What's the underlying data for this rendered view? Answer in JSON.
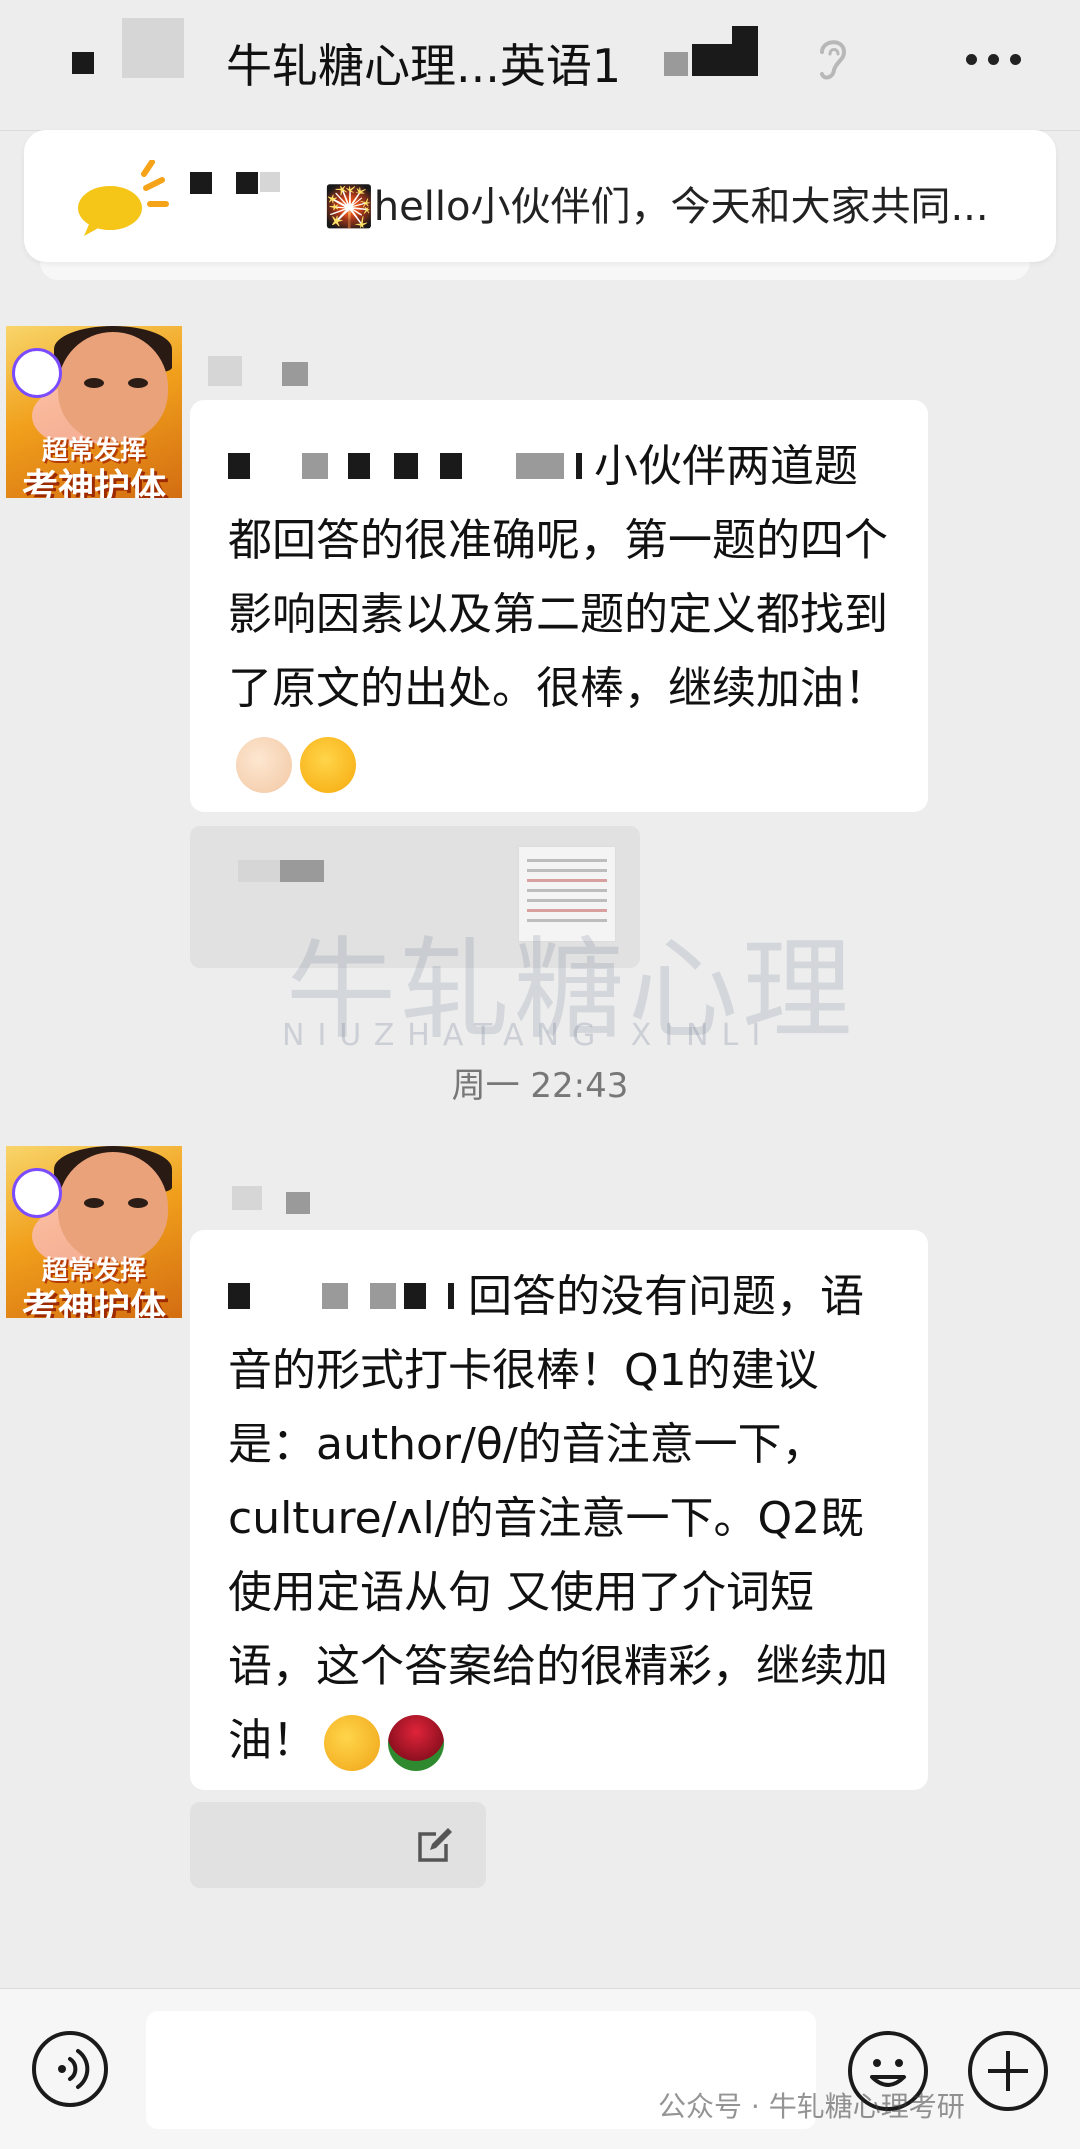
{
  "header": {
    "title": "牛轧糖心理...英语1",
    "ear_icon": "ear-icon",
    "more_icon": "more-icon"
  },
  "announcement": {
    "icon": "sun-icon",
    "text": "🎇hello小伙伴们，今天和大家共同..."
  },
  "messages": [
    {
      "avatar": {
        "icon": "avatar-cartoon",
        "line1": "超常发挥",
        "line2": "考神护体"
      },
      "text": "小伙伴两道题都回答的很准确呢，第一题的四个影响因素以及第二题的定义都找到了原文的出处。很棒，继续加油！",
      "emojis": [
        "clapping-hands",
        "partying-face"
      ]
    },
    {
      "avatar": {
        "icon": "avatar-cartoon",
        "line1": "超常发挥",
        "line2": "考神护体"
      },
      "text": "回答的没有问题，语音的形式打卡很棒！Q1的建议是：author/θ/的音注意一下，culture/ʌl/的音注意一下。Q2既使用定语从句 又使用了介词短语，这个答案给的很精彩，继续加油！",
      "emojis": [
        "thumbs-up",
        "rose"
      ]
    }
  ],
  "timestamp": "周一 22:43",
  "watermark": {
    "cn": "牛轧糖心理",
    "en": "NIUZHATANG XINLI"
  },
  "footer": {
    "watermark": "公众号 · 牛轧糖心理考研"
  },
  "colors": {
    "background": "#ededed",
    "bubble": "#ffffff",
    "announcement_icon": "#f5c518"
  }
}
